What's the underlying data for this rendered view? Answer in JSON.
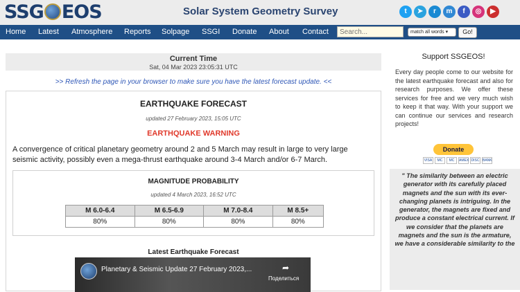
{
  "header": {
    "logo_text_a": "SSG",
    "logo_text_b": "EOS",
    "site_title": "Solar System Geometry Survey",
    "social": [
      {
        "name": "twitter-icon",
        "color": "#1da1f2",
        "glyph": "t"
      },
      {
        "name": "telegram-icon",
        "color": "#2aa3df",
        "glyph": "➤"
      },
      {
        "name": "reddit-icon",
        "color": "#1a8ad3",
        "glyph": "r"
      },
      {
        "name": "mastodon-icon",
        "color": "#3088d4",
        "glyph": "m"
      },
      {
        "name": "facebook-icon",
        "color": "#3b5bc4",
        "glyph": "f"
      },
      {
        "name": "instagram-icon",
        "color": "#d6337a",
        "glyph": "◎"
      },
      {
        "name": "youtube-icon",
        "color": "#cc2f2f",
        "glyph": "▶"
      }
    ]
  },
  "nav": {
    "items": [
      "Home",
      "Latest",
      "Atmosphere",
      "Reports",
      "Solpage",
      "SSGI",
      "Donate",
      "About",
      "Contact"
    ],
    "search_placeholder": "Search...",
    "search_mode": "match all words",
    "go_label": "Go!"
  },
  "time": {
    "label": "Current Time",
    "value": "Sat, 04 Mar 2023 23:05:31 UTC"
  },
  "refresh_text": ">> Refresh the page in your browser to make sure you have the latest forecast update. <<",
  "forecast": {
    "title": "EARTHQUAKE FORECAST",
    "updated": "updated 27 February 2023, 15:05 UTC",
    "warning": "EARTHQUAKE WARNING",
    "text": "A convergence of critical planetary geometry around 2 and 5 March may result in large to very large seismic activity, possibly even a mega-thrust earthquake around 3-4 March and/or 6-7 March.",
    "magnitude": {
      "title": "MAGNITUDE PROBABILITY",
      "updated": "updated 4 March 2023, 16:52 UTC",
      "headers": [
        "M 6.0-6.4",
        "M 6.5-6.9",
        "M 7.0-8.4",
        "M 8.5+"
      ],
      "values": [
        "80%",
        "80%",
        "80%",
        "80%"
      ]
    },
    "latest_label": "Latest Earthquake Forecast",
    "video_title": "Planetary & Seismic Update 27 February 2023,...",
    "video_share": "Поделиться"
  },
  "sidebar": {
    "support_title": "Support SSGEOS!",
    "support_text": "Every day people come to our website for the latest earthquake forecast and also for research purposes. We offer these services for free and we very much wish to keep it that way. With your support we can continue our services and research projects!",
    "donate_label": "Donate",
    "cards": [
      "VISA",
      "MC",
      "MC",
      "AMEX",
      "DISC",
      "BANK"
    ],
    "quote": "\" The similarity between an electric generator with its carefully placed magnets and the sun with its ever-changing planets is intriguing. In the generator, the magnets are fixed and produce a constant electrical current. If we consider that the planets are magnets and the sun is the armature, we have a considerable similarity to the"
  }
}
